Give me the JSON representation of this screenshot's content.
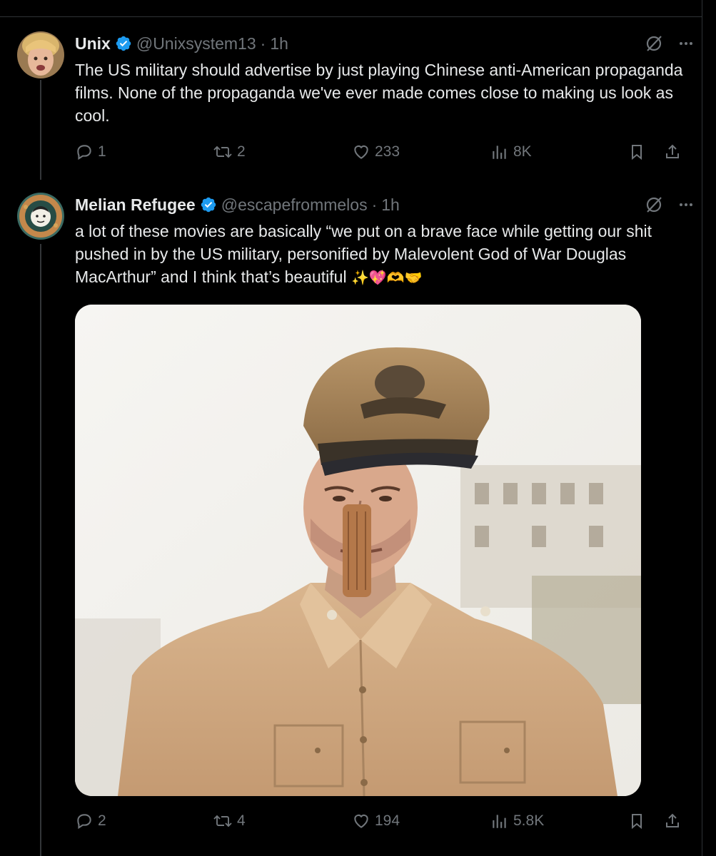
{
  "posts": [
    {
      "name": "Unix",
      "handle": "@Unixsystem13",
      "separator": "·",
      "time": "1h",
      "text": "The US military should advertise by just playing Chinese anti-American propaganda films. None of the propaganda we've ever made comes close to making us look as cool.",
      "replies": "1",
      "reposts": "2",
      "likes": "233",
      "views": "8K"
    },
    {
      "name": "Melian Refugee",
      "handle": "@escapefrommelos",
      "separator": "·",
      "time": "1h",
      "text": "a lot of these movies are basically “we put on a brave face while getting our shit pushed in by the US military, personified by Malevolent God of War Douglas MacArthur” and I think that’s beautiful",
      "emojis": "✨💖🫶🤝",
      "replies": "2",
      "reposts": "4",
      "likes": "194",
      "views": "5.8K"
    }
  ],
  "icons": {
    "verified": "verified-badge-icon",
    "grok": "grok-icon",
    "more": "more-icon",
    "reply": "reply-icon",
    "repost": "repost-icon",
    "like": "like-icon",
    "views": "views-icon",
    "bookmark": "bookmark-icon",
    "share": "share-icon"
  },
  "colors": {
    "background": "#000000",
    "text": "#e7e9ea",
    "muted": "#71767b",
    "verified": "#1d9bf0",
    "border": "#2f3336"
  }
}
